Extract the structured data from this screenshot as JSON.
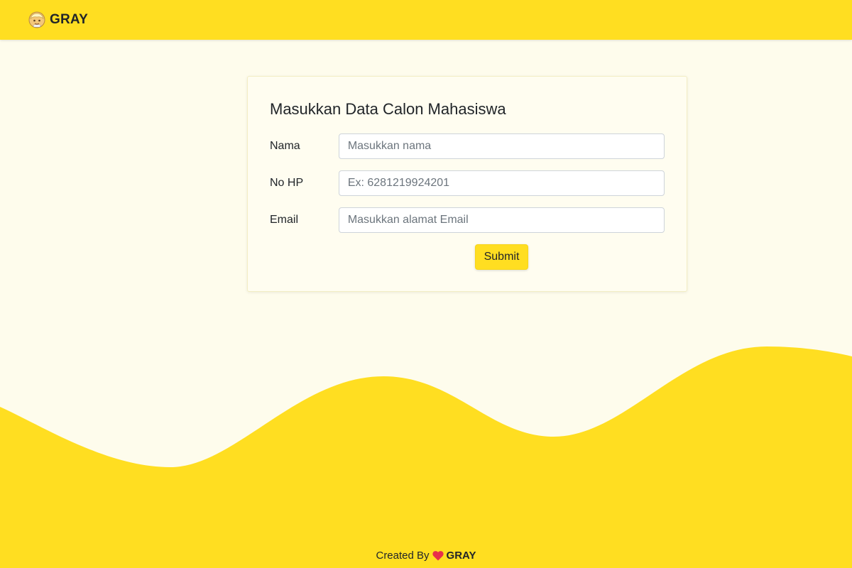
{
  "navbar": {
    "brand_text": "GRAY",
    "brand_logo_icon": "avatar-logo-icon",
    "background_color": "#ffde21"
  },
  "form": {
    "title": "Masukkan Data Calon Mahasiswa",
    "fields": [
      {
        "label": "Nama",
        "placeholder": "Masukkan nama",
        "value": ""
      },
      {
        "label": "No HP",
        "placeholder": "Ex: 6281219924201",
        "value": ""
      },
      {
        "label": "Email",
        "placeholder": "Masukkan alamat Email",
        "value": ""
      }
    ],
    "submit_label": "Submit"
  },
  "footer": {
    "prefix": "Created By",
    "heart_icon": "heart-icon",
    "heart_color": "#e8304a",
    "brand": "GRAY"
  },
  "colors": {
    "accent": "#ffde21",
    "page_background": "#fefcec"
  }
}
